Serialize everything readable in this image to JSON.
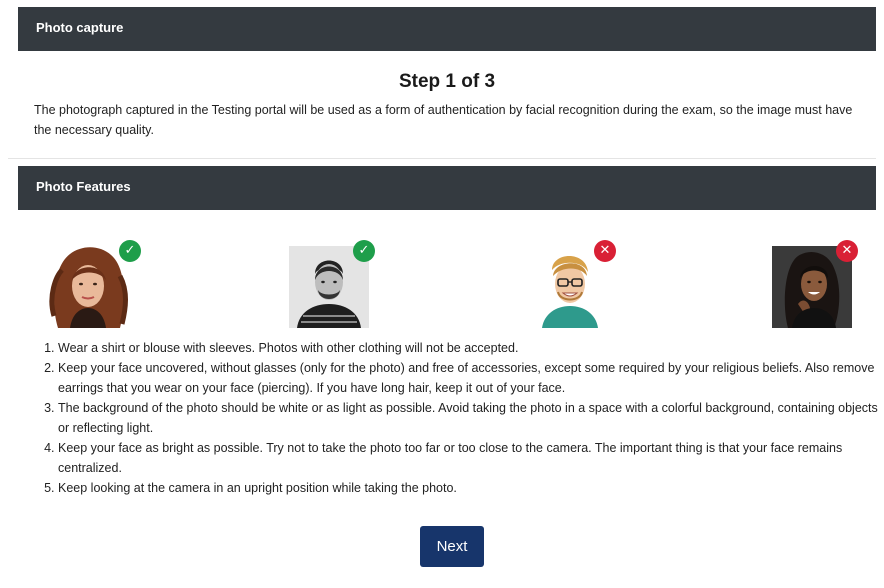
{
  "photo_capture": {
    "header": "Photo capture",
    "step_title": "Step 1 of 3",
    "intro": "The photograph captured in the Testing portal will be used as a form of authentication by facial recognition during the exam, so the image must have the necessary quality."
  },
  "photo_features": {
    "header": "Photo Features",
    "examples": [
      {
        "status": "accepted",
        "icon": "check-icon"
      },
      {
        "status": "accepted",
        "icon": "check-icon"
      },
      {
        "status": "rejected",
        "icon": "close-icon"
      },
      {
        "status": "rejected",
        "icon": "close-icon"
      }
    ],
    "rules": [
      "Wear a shirt or blouse with sleeves. Photos with other clothing will not be accepted.",
      "Keep your face uncovered, without glasses (only for the photo) and free of accessories, except some required by your religious beliefs. Also remove earrings that you wear on your face (piercing). If you have long hair, keep it out of your face.",
      "The background of the photo should be white or as light as possible. Avoid taking the photo in a space with a colorful background, containing objects or reflecting light.",
      "Keep your face as bright as possible. Try not to take the photo too far or too close to the camera. The important thing is that your face remains centralized.",
      "Keep looking at the camera in an upright position while taking the photo."
    ],
    "next_label": "Next"
  },
  "colors": {
    "header_bg": "#343a40",
    "accepted": "#1e9e4a",
    "rejected": "#d92035",
    "button": "#17356b"
  }
}
